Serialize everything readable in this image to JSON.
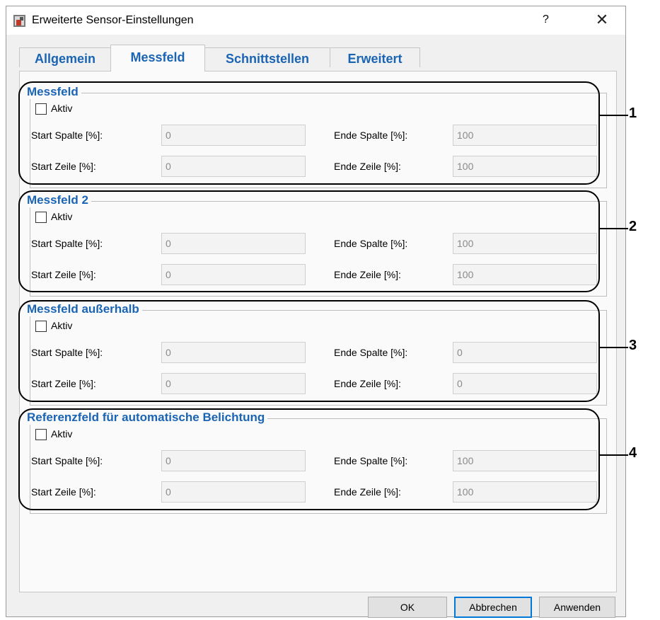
{
  "window": {
    "title": "Erweiterte Sensor-Einstellungen",
    "help": "?",
    "close": "✕"
  },
  "tabs": [
    "Allgemein",
    "Messfeld",
    "Schnittstellen",
    "Erweitert"
  ],
  "groups": [
    {
      "title": "Messfeld",
      "aktiv": "Aktiv",
      "start_spalte_label": "Start Spalte [%]:",
      "start_spalte": "0",
      "ende_spalte_label": "Ende Spalte [%]:",
      "ende_spalte": "100",
      "start_zeile_label": "Start Zeile [%]:",
      "start_zeile": "0",
      "ende_zeile_label": "Ende Zeile [%]:",
      "ende_zeile": "100"
    },
    {
      "title": "Messfeld 2",
      "aktiv": "Aktiv",
      "start_spalte_label": "Start Spalte [%]:",
      "start_spalte": "0",
      "ende_spalte_label": "Ende Spalte [%]:",
      "ende_spalte": "100",
      "start_zeile_label": "Start Zeile [%]:",
      "start_zeile": "0",
      "ende_zeile_label": "Ende Zeile [%]:",
      "ende_zeile": "100"
    },
    {
      "title": "Messfeld außerhalb",
      "aktiv": "Aktiv",
      "start_spalte_label": "Start Spalte [%]:",
      "start_spalte": "0",
      "ende_spalte_label": "Ende Spalte [%]:",
      "ende_spalte": "0",
      "start_zeile_label": "Start Zeile [%]:",
      "start_zeile": "0",
      "ende_zeile_label": "Ende Zeile [%]:",
      "ende_zeile": "0"
    },
    {
      "title": "Referenzfeld für automatische Belichtung",
      "aktiv": "Aktiv",
      "start_spalte_label": "Start Spalte [%]:",
      "start_spalte": "0",
      "ende_spalte_label": "Ende Spalte [%]:",
      "ende_spalte": "100",
      "start_zeile_label": "Start Zeile [%]:",
      "start_zeile": "0",
      "ende_zeile_label": "Ende Zeile [%]:",
      "ende_zeile": "100"
    }
  ],
  "callouts": [
    "1",
    "2",
    "3",
    "4"
  ],
  "buttons": {
    "ok": "OK",
    "cancel": "Abbrechen",
    "apply": "Anwenden"
  },
  "colors": {
    "accent": "#1a64b4",
    "default_button_border": "#0078d7"
  }
}
